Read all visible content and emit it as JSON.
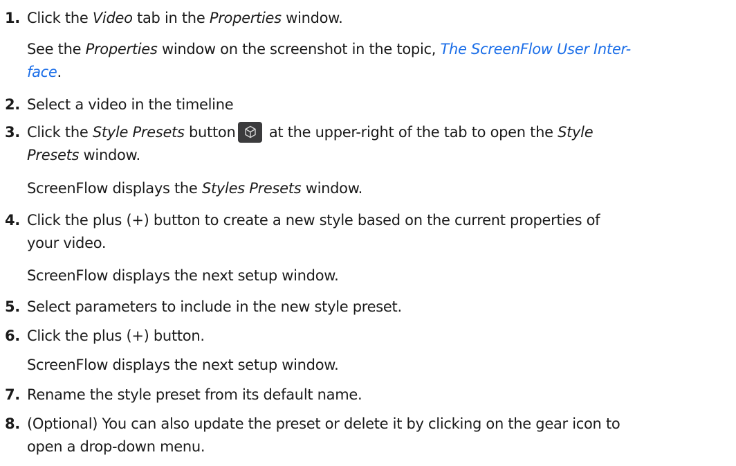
{
  "steps": [
    {
      "num": "1.",
      "pre": "Click the ",
      "em1": "Video",
      "mid": " tab in the ",
      "em2": "Properties",
      "post": " window.",
      "note": {
        "pre": "See the ",
        "em": "Properties",
        "mid": " window on the screenshot in the topic, ",
        "link_line1": "The ScreenFlow User Inter-",
        "link_line2": "face",
        "post": "."
      }
    },
    {
      "num": "2.",
      "text": "Select a video in the timeline"
    },
    {
      "num": "3.",
      "pre": "Click the ",
      "em1": "Style Presets",
      "mid": " button",
      "icon": "style-presets-cube-icon",
      "after": " at the upper-right of the tab to open the ",
      "em2": "Style",
      "line2_em": "Presets",
      "line2_post": " window.",
      "note": {
        "pre": "ScreenFlow displays the ",
        "em": "Styles Presets",
        "post": " window."
      }
    },
    {
      "num": "4.",
      "line1": "Click the plus (+) button to create a new style based on the current properties of",
      "line2": "your video.",
      "note": "ScreenFlow displays the next setup window."
    },
    {
      "num": "5.",
      "text": "Select parameters to include in the new style preset."
    },
    {
      "num": "6.",
      "text": "Click the plus (+) button.",
      "note": "ScreenFlow displays the next setup window."
    },
    {
      "num": "7.",
      "text": "Rename the style preset from its default name."
    },
    {
      "num": "8.",
      "line1": "(Optional) You can also update the preset or delete it by clicking on the gear icon to",
      "line2": "open a drop-down menu."
    }
  ],
  "colors": {
    "text": "#1a1a1a",
    "link": "#1b6ee8",
    "button_bg": "#3b3b3d",
    "button_icon": "#d8d8d8"
  }
}
